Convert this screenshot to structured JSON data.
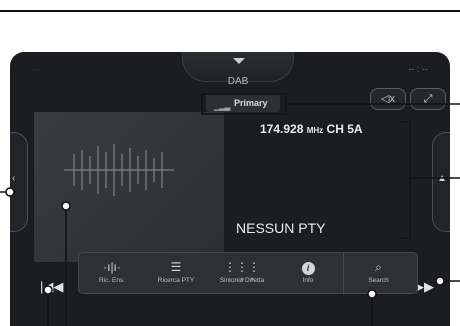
{
  "header": {
    "source_label": "DAB",
    "status_left": "···",
    "status_right": "-- : --"
  },
  "signal": {
    "bars_icon": "signal-bars-icon",
    "label": "Primary"
  },
  "station": {
    "frequency": "174.928",
    "unit": "MHz",
    "channel": "CH 5A",
    "pty": "NESSUN PTY"
  },
  "toolbar": {
    "items": [
      {
        "icon": "scan-ensemble-icon",
        "label": "Ric. Ens."
      },
      {
        "icon": "search-pty-icon",
        "label": "Ricerca PTY"
      },
      {
        "icon": "keypad-icon",
        "label": "Sintonia Diretta"
      },
      {
        "icon": "info-icon",
        "label": "Info"
      },
      {
        "icon": "search-icon",
        "label": "Search"
      }
    ]
  },
  "colors": {
    "screen_bg": "#1b1d20",
    "text": "#ececee",
    "bar": "#2e3034"
  }
}
